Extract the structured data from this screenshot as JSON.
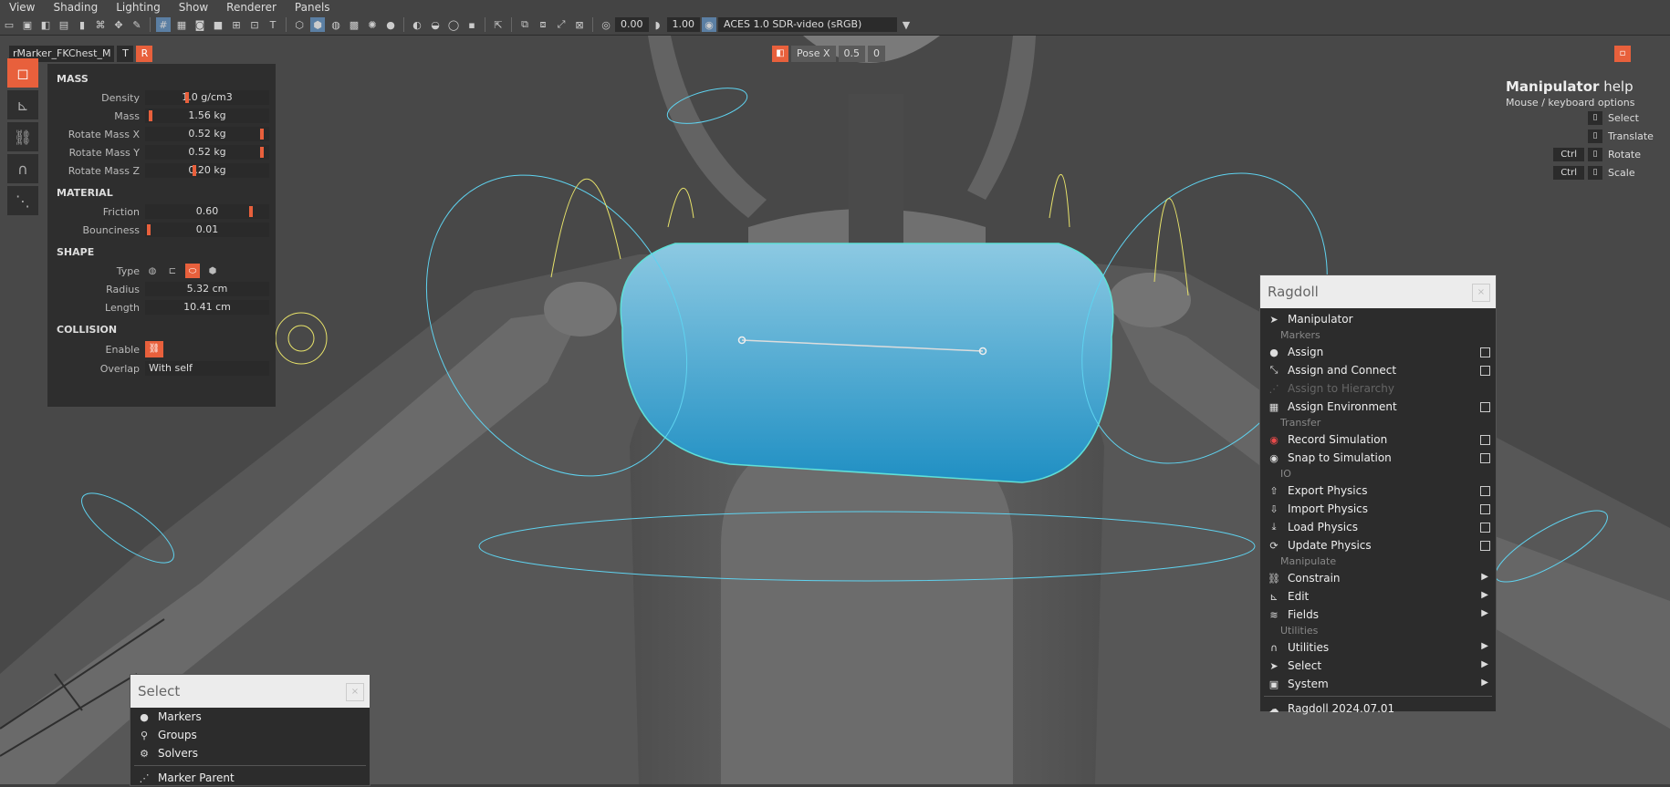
{
  "menu": [
    "View",
    "Shading",
    "Lighting",
    "Show",
    "Renderer",
    "Panels"
  ],
  "toolbar": {
    "exposure": "0.00",
    "gamma": "1.00",
    "colorspace": "ACES 1.0 SDR-video (sRGB)"
  },
  "marker": {
    "name": "rMarker_FKChest_M",
    "t_label": "T",
    "r_label": "R"
  },
  "properties": {
    "mass_header": "MASS",
    "density_label": "Density",
    "density": "1.0 g/cm3",
    "mass_label": "Mass",
    "mass": "1.56 kg",
    "rmx_label": "Rotate Mass X",
    "rmx": "0.52 kg",
    "rmy_label": "Rotate Mass Y",
    "rmy": "0.52 kg",
    "rmz_label": "Rotate Mass Z",
    "rmz": "0.20 kg",
    "material_header": "MATERIAL",
    "friction_label": "Friction",
    "friction": "0.60",
    "bounciness_label": "Bounciness",
    "bounciness": "0.01",
    "shape_header": "SHAPE",
    "type_label": "Type",
    "radius_label": "Radius",
    "radius": "5.32 cm",
    "length_label": "Length",
    "length": "10.41 cm",
    "collision_header": "COLLISION",
    "enable_label": "Enable",
    "overlap_label": "Overlap",
    "overlap": "With self"
  },
  "pose": {
    "label": "Pose X",
    "value1": "0.5",
    "value2": "0"
  },
  "help": {
    "title_bold": "Manipulator",
    "title_rest": " help",
    "subtitle": "Mouse / keyboard options",
    "select": "Select",
    "translate": "Translate",
    "rotate": "Rotate",
    "scale": "Scale",
    "ctrl": "Ctrl"
  },
  "ragdoll": {
    "title": "Ragdoll",
    "manipulator": "Manipulator",
    "markers_header": "Markers",
    "assign": "Assign",
    "assign_connect": "Assign and Connect",
    "assign_hierarchy": "Assign to Hierarchy",
    "assign_environment": "Assign Environment",
    "transfer_header": "Transfer",
    "record": "Record Simulation",
    "snap": "Snap to Simulation",
    "io_header": "IO",
    "export": "Export Physics",
    "import": "Import Physics",
    "load": "Load Physics",
    "update": "Update Physics",
    "manipulate_header": "Manipulate",
    "constrain": "Constrain",
    "edit": "Edit",
    "fields": "Fields",
    "utilities_header": "Utilities",
    "utilities": "Utilities",
    "select": "Select",
    "system": "System",
    "version": "Ragdoll 2024.07.01"
  },
  "select_popup": {
    "title": "Select",
    "markers": "Markers",
    "groups": "Groups",
    "solvers": "Solvers",
    "marker_parent": "Marker Parent"
  },
  "colors": {
    "accent": "#e8603c",
    "capsule": "#3fa9d6",
    "wire": "#5fd3f0",
    "yellow": "#e8e36a"
  }
}
